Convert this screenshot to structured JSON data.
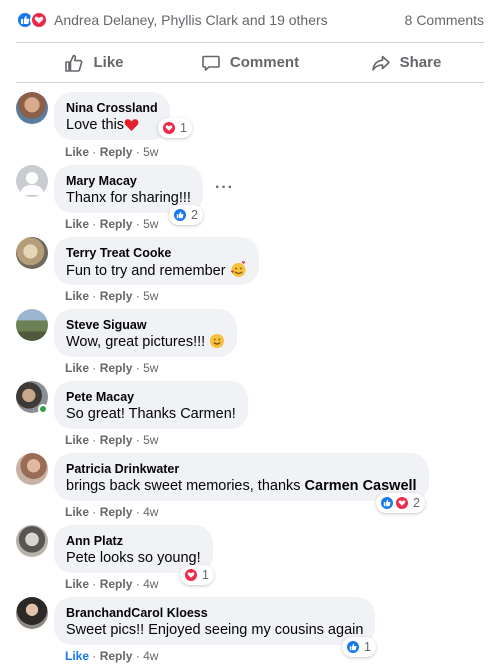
{
  "summary": {
    "names": "Andrea Delaney, Phyllis Clark and 19 others",
    "comments": "8 Comments",
    "icons": [
      "like-reaction-icon",
      "love-reaction-icon"
    ]
  },
  "actions": {
    "like": "Like",
    "comment": "Comment",
    "share": "Share"
  },
  "meta": {
    "like": "Like",
    "sep": "·",
    "reply": "Reply"
  },
  "colors": {
    "like_blue": "#1877f2",
    "love_red": "#f0284a",
    "bubble_gray": "#f0f2f5",
    "muted_text": "#65676b",
    "online_green": "#31a24c"
  },
  "comments": [
    {
      "name": "Nina Crossland",
      "text": "Love this",
      "emoji": "heart",
      "time": "5w",
      "reaction_count": "1",
      "reaction_type": "love"
    },
    {
      "name": "Mary Macay",
      "text": "Thanx for sharing!!!",
      "time": "5w",
      "reaction_count": "2",
      "reaction_type": "like",
      "more": "···"
    },
    {
      "name": "Terry Treat Cooke",
      "text": "Fun to try and remember",
      "emoji": "smiling-hearts-face",
      "time": "5w"
    },
    {
      "name": "Steve Siguaw",
      "text": "Wow, great pictures!!!",
      "emoji": "smile-face",
      "time": "5w"
    },
    {
      "name": "Pete Macay",
      "text": "So great! Thanks Carmen!",
      "time": "5w",
      "online": true
    },
    {
      "name": "Patricia Drinkwater",
      "text": "brings back sweet memories, thanks",
      "mention": "Carmen Caswell",
      "time": "4w",
      "reaction_count": "2",
      "reaction_type": "like-love"
    },
    {
      "name": "Ann Platz",
      "text": "Pete looks so young!",
      "time": "4w",
      "reaction_count": "1",
      "reaction_type": "love"
    },
    {
      "name": "BranchandCarol Kloess",
      "text": "Sweet pics!! Enjoyed seeing my cousins again",
      "time": "4w",
      "reaction_count": "1",
      "reaction_type": "like"
    }
  ]
}
